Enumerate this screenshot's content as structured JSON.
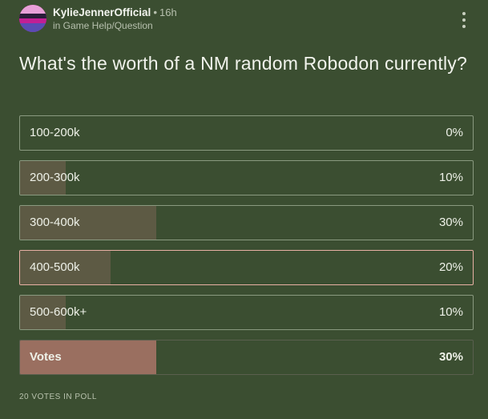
{
  "header": {
    "username": "KylieJennerOfficial",
    "separator": "•",
    "time": "16h",
    "community": "in Game Help/Question",
    "more_icon": "kebab-vertical-icon"
  },
  "question": "What's the worth of a NM random Robodon currently?",
  "options": [
    {
      "label": "100-200k",
      "percent_text": "0%",
      "percent": 0,
      "selected": false,
      "winner": false
    },
    {
      "label": "200-300k",
      "percent_text": "10%",
      "percent": 10,
      "selected": false,
      "winner": false
    },
    {
      "label": "300-400k",
      "percent_text": "30%",
      "percent": 30,
      "selected": false,
      "winner": false
    },
    {
      "label": "400-500k",
      "percent_text": "20%",
      "percent": 20,
      "selected": true,
      "winner": false
    },
    {
      "label": "500-600k+",
      "percent_text": "10%",
      "percent": 10,
      "selected": false,
      "winner": false
    },
    {
      "label": "Votes",
      "percent_text": "30%",
      "percent": 30,
      "selected": false,
      "winner": true
    }
  ],
  "footer": "20 VOTES IN POLL",
  "colors": {
    "background": "#3b4e31",
    "bar_fill": "#5d5a44",
    "winner_fill": "#9a6f60",
    "selected_border": "#e8b0a4"
  }
}
